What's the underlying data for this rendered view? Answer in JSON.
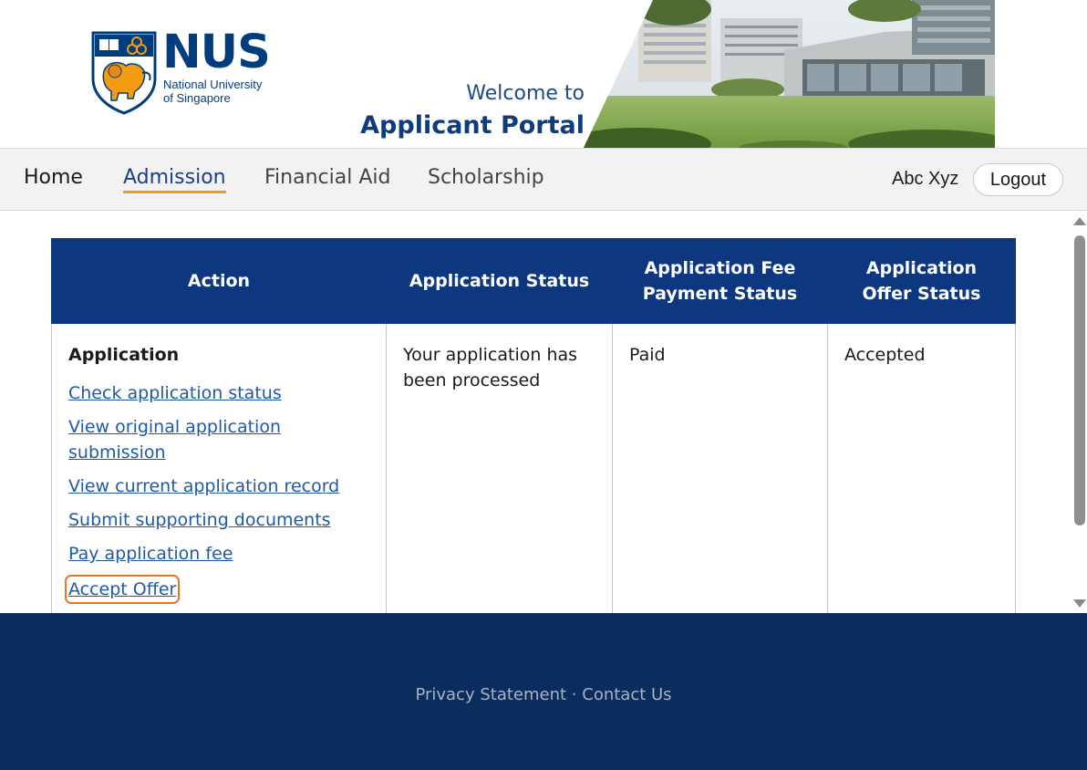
{
  "header": {
    "logo_word": "NUS",
    "logo_sub_line1": "National University",
    "logo_sub_line2": "of Singapore",
    "welcome": "Welcome to",
    "portal_title": "Applicant Portal"
  },
  "nav": {
    "items": [
      {
        "label": "Home"
      },
      {
        "label": "Admission",
        "active": true
      },
      {
        "label": "Financial Aid"
      },
      {
        "label": "Scholarship"
      }
    ],
    "user_name": "Abc Xyz",
    "logout_label": "Logout"
  },
  "table": {
    "headers": [
      "Action",
      "Application Status",
      "Application Fee Payment Status",
      "Application Offer Status"
    ],
    "row": {
      "section_title": "Application",
      "links": [
        "Check application status",
        "View original application submission",
        "View current application record",
        "Submit supporting documents",
        "Pay application fee",
        "Accept Offer"
      ],
      "application_status": "Your application has been processed",
      "fee_status": "Paid",
      "offer_status": "Accepted"
    }
  },
  "footer": {
    "privacy": "Privacy Statement",
    "separator": "·",
    "contact": "Contact Us"
  },
  "colors": {
    "brand_blue": "#003d7c",
    "header_cell": "#0d3880",
    "footer_bg": "#0a2d5e",
    "link": "#1f5aa6",
    "active_underline": "#f39c12",
    "highlight_outline": "#e8742a"
  }
}
